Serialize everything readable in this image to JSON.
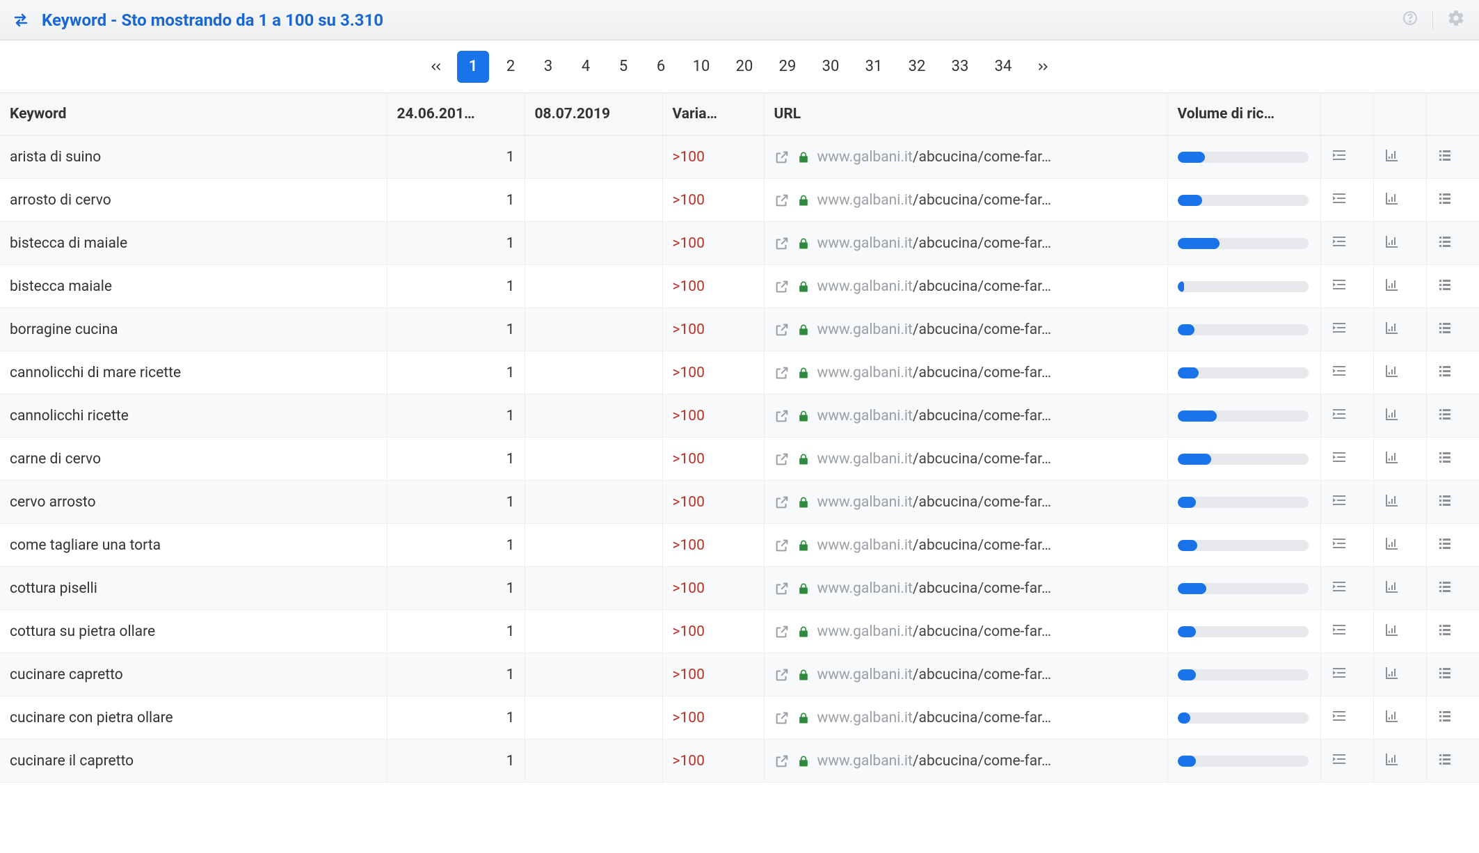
{
  "header": {
    "title": "Keyword - Sto mostrando da 1 a 100 su 3.310"
  },
  "pagination": {
    "pages": [
      "1",
      "2",
      "3",
      "4",
      "5",
      "6",
      "10",
      "20",
      "29",
      "30",
      "31",
      "32",
      "33",
      "34"
    ],
    "active": "1"
  },
  "columns": {
    "keyword": "Keyword",
    "date1": "24.06.201…",
    "date2": "08.07.2019",
    "varia": "Varia…",
    "url": "URL",
    "volume": "Volume di ric…"
  },
  "url_common": {
    "domain": "www.galbani.it",
    "path_truncated": "/abcucina/come-far…"
  },
  "rows": [
    {
      "keyword": "arista di suino",
      "date1": "1",
      "date2": "",
      "varia": ">100",
      "volume_pct": 21
    },
    {
      "keyword": "arrosto di cervo",
      "date1": "1",
      "date2": "",
      "varia": ">100",
      "volume_pct": 19
    },
    {
      "keyword": "bistecca di maiale",
      "date1": "1",
      "date2": "",
      "varia": ">100",
      "volume_pct": 32
    },
    {
      "keyword": "bistecca maiale",
      "date1": "1",
      "date2": "",
      "varia": ">100",
      "volume_pct": 5
    },
    {
      "keyword": "borragine cucina",
      "date1": "1",
      "date2": "",
      "varia": ">100",
      "volume_pct": 13
    },
    {
      "keyword": "cannolicchi di mare ricette",
      "date1": "1",
      "date2": "",
      "varia": ">100",
      "volume_pct": 16
    },
    {
      "keyword": "cannolicchi ricette",
      "date1": "1",
      "date2": "",
      "varia": ">100",
      "volume_pct": 30
    },
    {
      "keyword": "carne di cervo",
      "date1": "1",
      "date2": "",
      "varia": ">100",
      "volume_pct": 26
    },
    {
      "keyword": "cervo arrosto",
      "date1": "1",
      "date2": "",
      "varia": ">100",
      "volume_pct": 14
    },
    {
      "keyword": "come tagliare una torta",
      "date1": "1",
      "date2": "",
      "varia": ">100",
      "volume_pct": 15
    },
    {
      "keyword": "cottura piselli",
      "date1": "1",
      "date2": "",
      "varia": ">100",
      "volume_pct": 22
    },
    {
      "keyword": "cottura su pietra ollare",
      "date1": "1",
      "date2": "",
      "varia": ">100",
      "volume_pct": 14
    },
    {
      "keyword": "cucinare capretto",
      "date1": "1",
      "date2": "",
      "varia": ">100",
      "volume_pct": 14
    },
    {
      "keyword": "cucinare con pietra ollare",
      "date1": "1",
      "date2": "",
      "varia": ">100",
      "volume_pct": 10
    },
    {
      "keyword": "cucinare il capretto",
      "date1": "1",
      "date2": "",
      "varia": ">100",
      "volume_pct": 14
    }
  ]
}
